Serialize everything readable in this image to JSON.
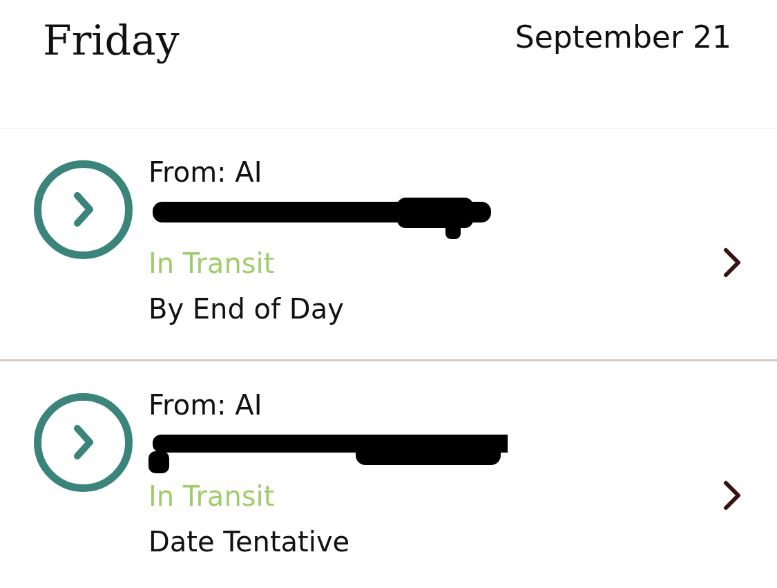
{
  "header": {
    "day": "Friday",
    "date": "September 21"
  },
  "shipments": [
    {
      "sender": "From: AI",
      "status": "In Transit",
      "delivery": "By End of Day"
    },
    {
      "sender": "From: AI",
      "status": "In Transit",
      "delivery": "Date Tentative"
    }
  ]
}
